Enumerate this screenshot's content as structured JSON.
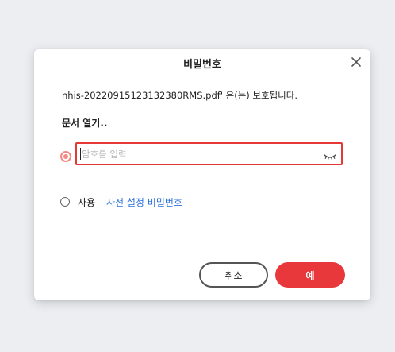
{
  "dialog": {
    "title": "비밀번호",
    "message": "nhis-20220915123132380RMS.pdf' 은(는) 보호됩니다.",
    "section_label": "문서 열기..",
    "password_input": {
      "value": "",
      "placeholder": "암호를 입력"
    },
    "preset_option": {
      "use_label": "사용",
      "link_text": "사전 설정 비밀번호"
    },
    "buttons": {
      "cancel_label": "취소",
      "ok_label": "예"
    }
  },
  "icons": {
    "close": "close-icon",
    "eye_toggle": "eye-closed-icon"
  },
  "colors": {
    "accent_red": "#e8383b",
    "field_border": "#e53935",
    "radio_selected": "#f28a86",
    "link": "#2f73d8",
    "backdrop": "#eceef2"
  }
}
